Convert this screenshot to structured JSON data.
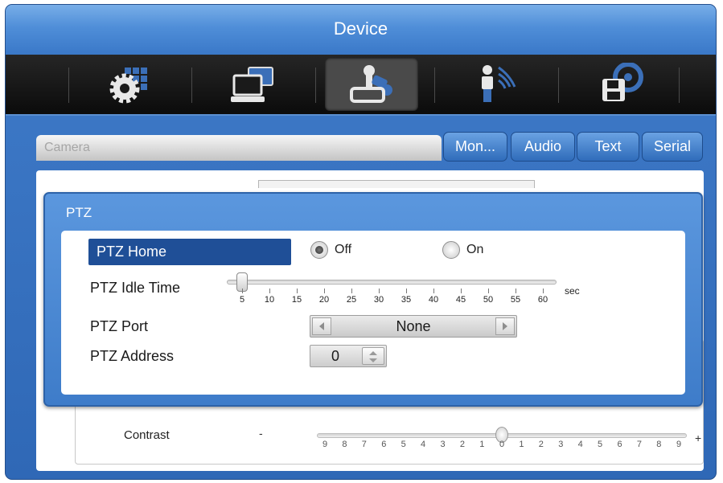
{
  "window": {
    "title": "Device"
  },
  "icon_bar": {
    "icons": [
      {
        "name": "system-settings-icon",
        "active": false
      },
      {
        "name": "computer-network-icon",
        "active": false
      },
      {
        "name": "ptz-camera-icon",
        "active": true
      },
      {
        "name": "event-sensor-icon",
        "active": false
      },
      {
        "name": "storage-disk-icon",
        "active": false
      }
    ]
  },
  "sub_tabs": {
    "camera": "Camera",
    "buttons": [
      "Mon...",
      "Audio",
      "Text",
      "Serial"
    ]
  },
  "background": {
    "contrast_label": "Contrast",
    "scale_ticks": [
      "9",
      "8",
      "7",
      "6",
      "5",
      "4",
      "3",
      "2",
      "1",
      "0",
      "1",
      "2",
      "3",
      "4",
      "5",
      "6",
      "7",
      "8",
      "9"
    ],
    "minus": "-",
    "plus": "+"
  },
  "ptz": {
    "title": "PTZ",
    "home": {
      "label": "PTZ Home",
      "options": [
        {
          "label": "Off",
          "selected": true
        },
        {
          "label": "On",
          "selected": false
        }
      ]
    },
    "idle_time": {
      "label": "PTZ Idle Time",
      "ticks": [
        "5",
        "10",
        "15",
        "20",
        "25",
        "30",
        "35",
        "40",
        "45",
        "50",
        "55",
        "60"
      ],
      "value": 5,
      "unit": "sec"
    },
    "port": {
      "label": "PTZ Port",
      "value": "None"
    },
    "address": {
      "label": "PTZ Address",
      "value": "0"
    }
  },
  "colors": {
    "accent_blue": "#3e7cc9",
    "selected_label_bg": "#1f4f97",
    "icon_bar_bg": "#111111"
  }
}
